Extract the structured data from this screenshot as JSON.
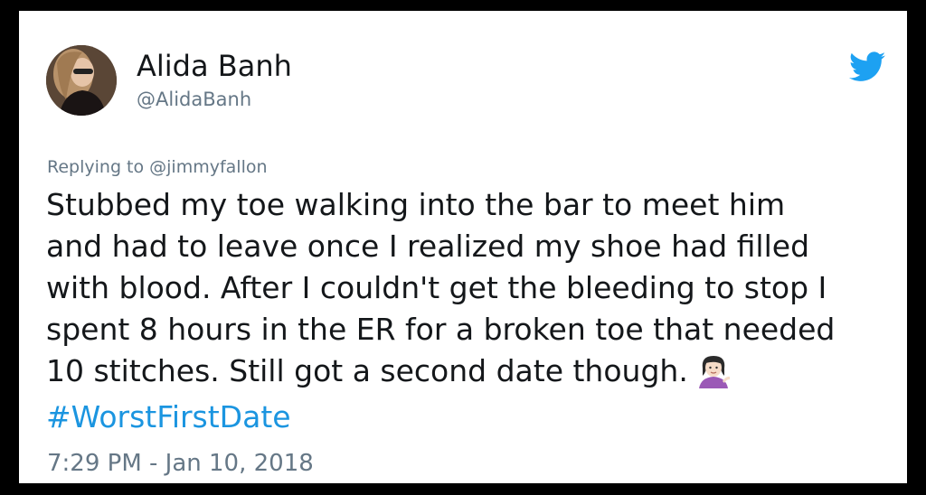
{
  "tweet": {
    "author_name": "Alida Banh",
    "author_handle": "@AlidaBanh",
    "replying_prefix": "Replying to ",
    "replying_to": "@jimmyfallon",
    "text_lines": [
      "Stubbed my toe walking into the bar to meet him",
      "and had to leave once I realized my shoe had filled",
      "with blood. After I couldn't get the bleeding to stop I",
      "spent 8 hours in the ER for a broken toe that needed",
      "10 stitches. Still got a second date though."
    ],
    "emoji": "person-tipping-hand-emoji",
    "hashtag": "#WorstFirstDate",
    "timestamp": "7:29 PM - Jan 10, 2018"
  },
  "icons": {
    "brand": "twitter-bird-icon"
  },
  "colors": {
    "text": "#14171a",
    "secondary": "#657786",
    "link": "#1b95e0",
    "twitter_blue": "#1da1f2",
    "frame": "#000000"
  }
}
